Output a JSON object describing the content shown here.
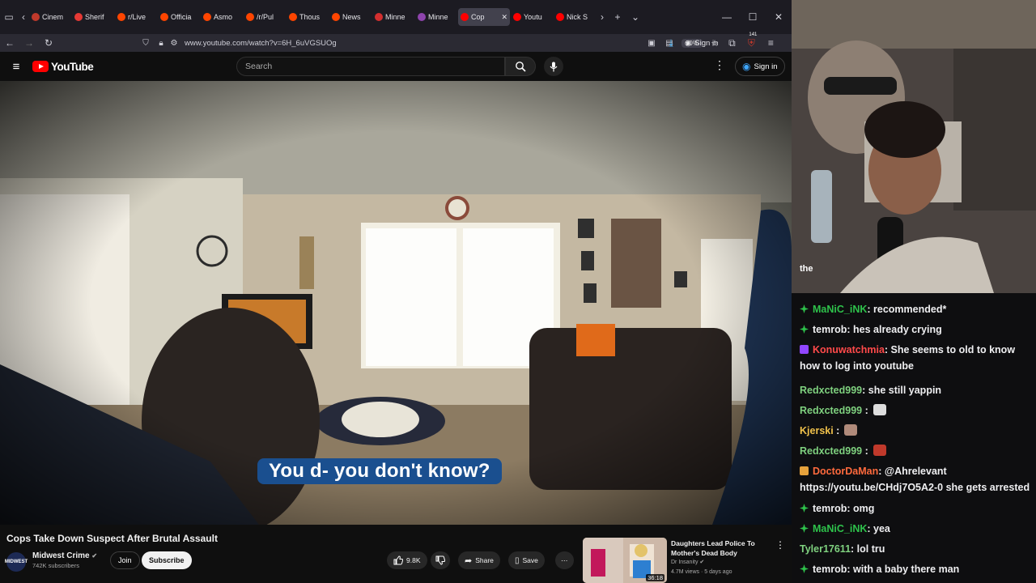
{
  "browser": {
    "tabs": [
      {
        "label": "Cinem",
        "color": "#c0392b"
      },
      {
        "label": "Sherif",
        "color": "#e53935"
      },
      {
        "label": "r/Live",
        "color": "#ff4500"
      },
      {
        "label": "Officia",
        "color": "#ff4500"
      },
      {
        "label": "Asmo",
        "color": "#ff4500"
      },
      {
        "label": "/r/Pul",
        "color": "#ff4500"
      },
      {
        "label": "Thous",
        "color": "#ff4500"
      },
      {
        "label": "News",
        "color": "#ff4500"
      },
      {
        "label": "Minne",
        "color": "#d32f2f"
      },
      {
        "label": "Minne",
        "color": "#8e44ad"
      },
      {
        "label": "Cop",
        "color": "#ff0000",
        "active": true
      },
      {
        "label": "Youtu",
        "color": "#ff0000"
      },
      {
        "label": "Nick S",
        "color": "#ff0000"
      }
    ],
    "url": "www.youtube.com/watch?v=6H_6uVGSUOg",
    "zoom": "90%",
    "signin_label": "Sign in",
    "ext_badge": "141"
  },
  "youtube": {
    "logo_text": "YouTube",
    "search_placeholder": "Search",
    "signin_label": "Sign in"
  },
  "video": {
    "subtitle": "You d- you don't know?",
    "title": "Cops Take Down Suspect After Brutal Assault",
    "channel": "Midwest Crime",
    "channel_avatar_text": "MIDWEST",
    "subscribers": "742K subscribers",
    "join_label": "Join",
    "subscribe_label": "Subscribe",
    "likes": "9.8K",
    "share_label": "Share",
    "save_label": "Save"
  },
  "recommended": {
    "title": "Daughters Lead Police To Mother's Dead Body",
    "channel": "Dr Insanity",
    "meta": "4.7M views · 5 days ago",
    "duration": "36:18"
  },
  "stream": {
    "overlay_text": "the",
    "chat": [
      {
        "badge": "green",
        "user": "MaNiC_iNK",
        "user_color": "#2ec24b",
        "text": ": recommended*"
      },
      {
        "badge": "green",
        "user": "temrob",
        "user_color": "#efeff1",
        "text": ": hes already crying"
      },
      {
        "badge": "purple",
        "user": "Konuwatchmia",
        "user_color": "#ff4a4a",
        "text": ": She seems to old to know how to log into youtube"
      },
      {
        "badge": "",
        "user": "Redxcted999",
        "user_color": "#7fd17f",
        "text": ": she still yappin"
      },
      {
        "badge": "",
        "user": "Redxcted999",
        "user_color": "#7fd17f",
        "text": " :",
        "emote": "#ddd"
      },
      {
        "badge": "",
        "user": "Kjerski",
        "user_color": "#f0c14b",
        "text": " :",
        "emote": "#b08a7a"
      },
      {
        "badge": "",
        "user": "Redxcted999",
        "user_color": "#7fd17f",
        "text": " :",
        "emote": "#c0392b"
      },
      {
        "badge": "gold",
        "user": "DoctorDaMan",
        "user_color": "#ff6a3d",
        "text": ": @Ahrelevant https://youtu.be/CHdj7O5A2-0 she gets arrested"
      },
      {
        "badge": "green",
        "user": "temrob",
        "user_color": "#efeff1",
        "text": ": omg"
      },
      {
        "badge": "green",
        "user": "MaNiC_iNK",
        "user_color": "#2ec24b",
        "text": ": yea"
      },
      {
        "badge": "",
        "user": "Tyler17611",
        "user_color": "#7fd17f",
        "text": ": lol tru"
      },
      {
        "badge": "green",
        "user": "temrob",
        "user_color": "#efeff1",
        "text": ": with a baby there man"
      }
    ]
  }
}
